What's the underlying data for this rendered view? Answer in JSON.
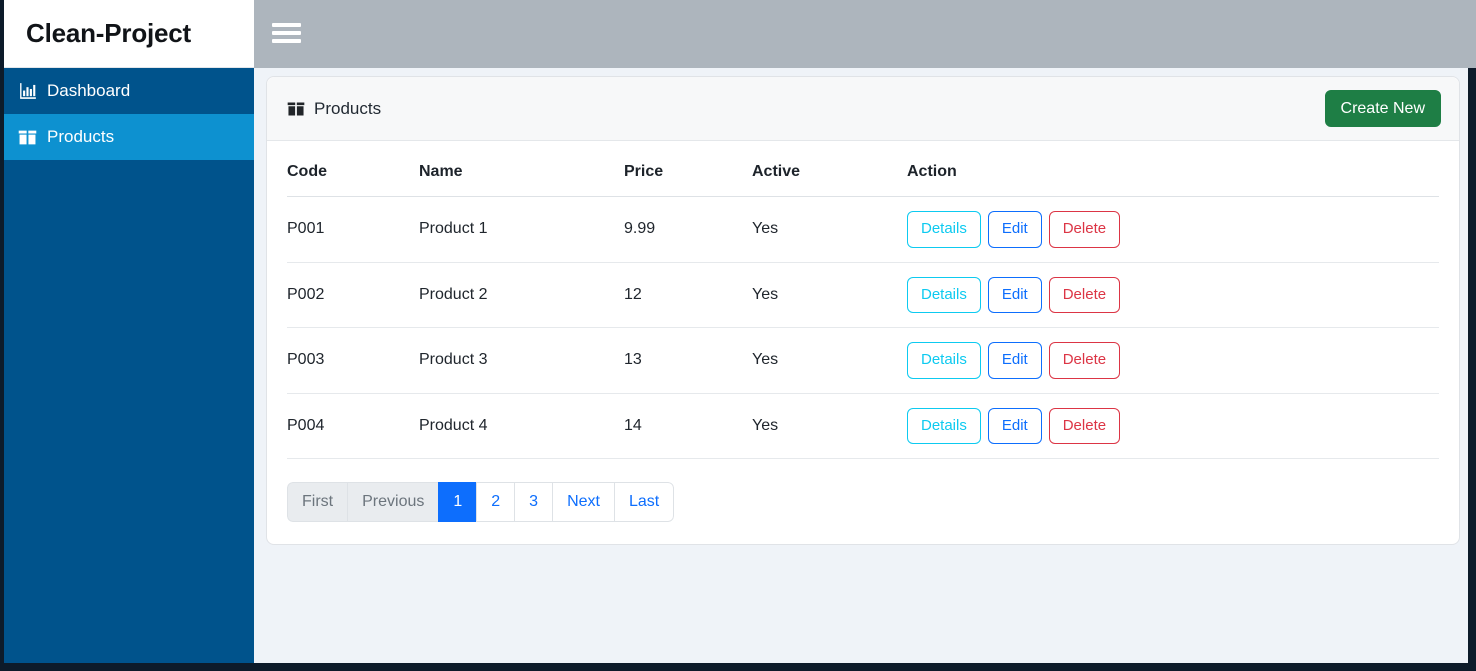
{
  "brand": {
    "title": "Clean-Project"
  },
  "topbar": {
    "menu_icon": "hamburger-icon"
  },
  "sidebar": {
    "items": [
      {
        "label": "Dashboard",
        "icon": "chart-bar-icon",
        "active": false
      },
      {
        "label": "Products",
        "icon": "box-icon",
        "active": true
      }
    ]
  },
  "card": {
    "title": "Products",
    "title_icon": "box-icon",
    "create_button": "Create New"
  },
  "table": {
    "columns": [
      "Code",
      "Name",
      "Price",
      "Active",
      "Action"
    ],
    "rows": [
      {
        "code": "P001",
        "name": "Product 1",
        "price": "9.99",
        "active": "Yes"
      },
      {
        "code": "P002",
        "name": "Product 2",
        "price": "12",
        "active": "Yes"
      },
      {
        "code": "P003",
        "name": "Product 3",
        "price": "13",
        "active": "Yes"
      },
      {
        "code": "P004",
        "name": "Product 4",
        "price": "14",
        "active": "Yes"
      }
    ],
    "row_actions": {
      "details": "Details",
      "edit": "Edit",
      "delete": "Delete"
    }
  },
  "pagination": {
    "items": [
      {
        "label": "First",
        "state": "disabled"
      },
      {
        "label": "Previous",
        "state": "disabled"
      },
      {
        "label": "1",
        "state": "active"
      },
      {
        "label": "2",
        "state": "normal"
      },
      {
        "label": "3",
        "state": "normal"
      },
      {
        "label": "Next",
        "state": "normal"
      },
      {
        "label": "Last",
        "state": "normal"
      }
    ]
  },
  "colors": {
    "sidebar_bg": "#00538c",
    "sidebar_active": "#0d91d0",
    "topbar_bg": "#adb5bd",
    "content_bg": "#eff3f8",
    "create_green": "#1e7e45",
    "primary_blue": "#0d6efd",
    "info_cyan": "#0dcaf0",
    "danger_red": "#dc3545",
    "edge_navy": "#0d1b2a"
  }
}
